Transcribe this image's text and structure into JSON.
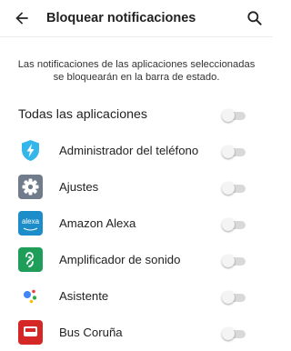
{
  "header": {
    "title": "Bloquear notificaciones",
    "back_icon": "arrow-back-icon",
    "search_icon": "search-icon"
  },
  "description": {
    "line1": "Las notificaciones de las aplicaciones seleccionadas",
    "line2": "se bloquearán en la barra de estado."
  },
  "all_apps": {
    "label": "Todas las aplicaciones",
    "toggle_on": false
  },
  "apps": [
    {
      "label": "Administrador del teléfono",
      "icon": "phone-manager-icon",
      "toggle_on": false,
      "color": "#35b6ea"
    },
    {
      "label": "Ajustes",
      "icon": "settings-gear-icon",
      "toggle_on": false,
      "color": "#707b8c"
    },
    {
      "label": "Amazon Alexa",
      "icon": "alexa-icon",
      "icon_text": "alexa",
      "toggle_on": false,
      "color": "#1d8dc9"
    },
    {
      "label": "Amplificador de sonido",
      "icon": "sound-amplifier-icon",
      "toggle_on": false,
      "color": "#1f9e59"
    },
    {
      "label": "Asistente",
      "icon": "assistant-icon",
      "toggle_on": false
    },
    {
      "label": "Bus Coruña",
      "icon": "bus-icon",
      "toggle_on": false,
      "color": "#d62727"
    }
  ]
}
